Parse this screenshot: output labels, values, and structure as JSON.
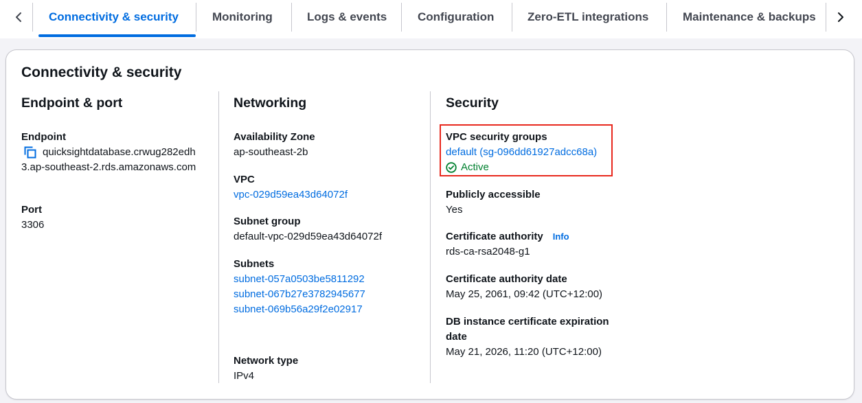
{
  "tabs": [
    {
      "label": "Connectivity & security",
      "active": true
    },
    {
      "label": "Monitoring"
    },
    {
      "label": "Logs & events"
    },
    {
      "label": "Configuration"
    },
    {
      "label": "Zero-ETL integrations"
    },
    {
      "label": "Maintenance & backups"
    }
  ],
  "section": {
    "title": "Connectivity & security",
    "endpoint_port": {
      "heading": "Endpoint & port",
      "endpoint_label": "Endpoint",
      "endpoint_value": "quicksightdatabase.crwug282edh3.ap-southeast-2.rds.amazonaws.com",
      "port_label": "Port",
      "port_value": "3306"
    },
    "networking": {
      "heading": "Networking",
      "az_label": "Availability Zone",
      "az_value": "ap-southeast-2b",
      "vpc_label": "VPC",
      "vpc_value": "vpc-029d59ea43d64072f",
      "subnet_group_label": "Subnet group",
      "subnet_group_value": "default-vpc-029d59ea43d64072f",
      "subnets_label": "Subnets",
      "subnets": [
        "subnet-057a0503be5811292",
        "subnet-067b27e3782945677",
        "subnet-069b56a29f2e02917"
      ],
      "network_type_label": "Network type",
      "network_type_value": "IPv4"
    },
    "security": {
      "heading": "Security",
      "sg_label": "VPC security groups",
      "sg_value": "default (sg-096dd61927adcc68a)",
      "sg_status": "Active",
      "public_label": "Publicly accessible",
      "public_value": "Yes",
      "ca_label": "Certificate authority",
      "ca_info": "Info",
      "ca_value": "rds-ca-rsa2048-g1",
      "ca_date_label": "Certificate authority date",
      "ca_date_value": "May 25, 2061, 09:42 (UTC+12:00)",
      "cert_exp_label_line1": "DB instance certificate expiration",
      "cert_exp_label_line2": "date",
      "cert_exp_value": "May 21, 2026, 11:20 (UTC+12:00)"
    }
  },
  "icons": {
    "prev": "chevron-left-icon",
    "next": "chevron-right-icon",
    "copy": "copy-icon",
    "status": "check-circle-icon"
  },
  "colors": {
    "accent": "#006ce0",
    "success": "#00802f",
    "highlight": "#e8271c"
  }
}
